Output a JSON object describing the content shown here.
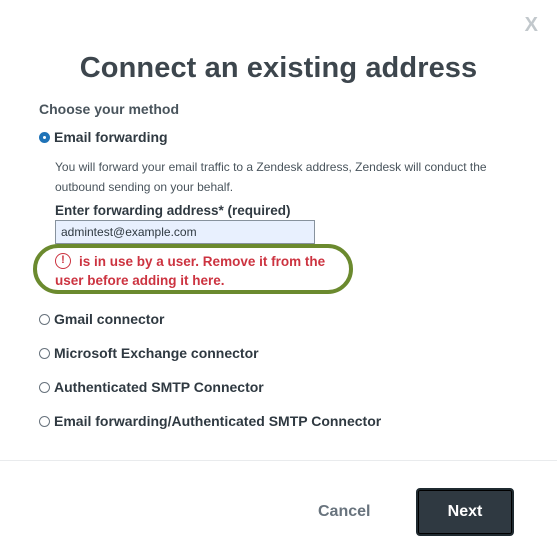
{
  "dialog": {
    "close_label": "X",
    "title": "Connect an existing address",
    "method_label": "Choose your method",
    "methods": [
      {
        "label": "Email forwarding",
        "selected": true
      },
      {
        "label": "Gmail connector",
        "selected": false
      },
      {
        "label": "Microsoft Exchange connector",
        "selected": false
      },
      {
        "label": "Authenticated SMTP Connector",
        "selected": false
      },
      {
        "label": "Email forwarding/Authenticated SMTP Connector",
        "selected": false
      }
    ],
    "forwarding_description": "You will forward your email traffic to a Zendesk address, Zendesk will conduct the outbound sending on your behalf.",
    "field_label": "Enter forwarding address* (required)",
    "field_value": "admintest@example.com",
    "error_icon": "!",
    "error_message": "is in use by a user. Remove it from the user before adding it here.",
    "cancel_label": "Cancel",
    "next_label": "Next"
  },
  "colors": {
    "accent": "#1f73b7",
    "error": "#cc3340",
    "highlight": "#6b8a2e",
    "primary_button": "#2f3941"
  }
}
